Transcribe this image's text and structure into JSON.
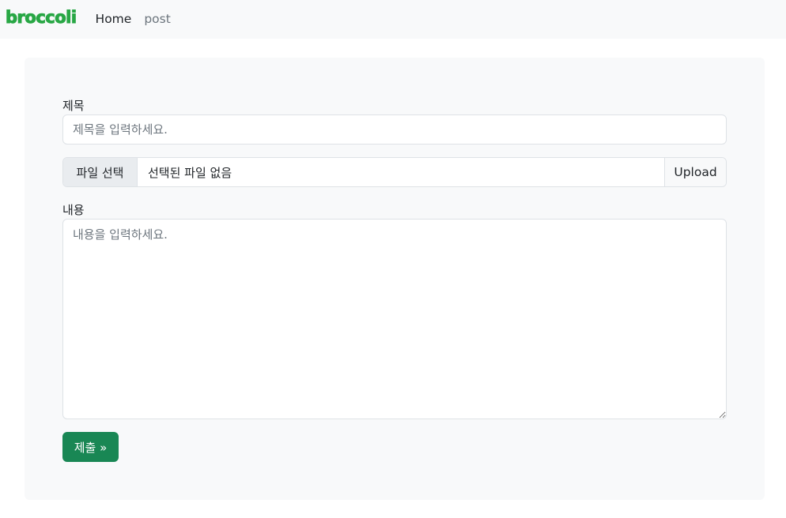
{
  "navbar": {
    "brand": "broccoli",
    "links": [
      {
        "label": "Home",
        "active": true
      },
      {
        "label": "post",
        "active": false
      }
    ]
  },
  "form": {
    "title_label": "제목",
    "title_placeholder": "제목을 입력하세요.",
    "title_value": "",
    "file_choose_label": "파일 선택",
    "file_name": "선택된 파일 없음",
    "upload_label": "Upload",
    "content_label": "내용",
    "content_placeholder": "내용을 입력하세요.",
    "content_value": "",
    "submit_label": "제출 »"
  },
  "colors": {
    "brand": "#28a745",
    "submit": "#198754",
    "card_bg": "#f8f9fa"
  }
}
